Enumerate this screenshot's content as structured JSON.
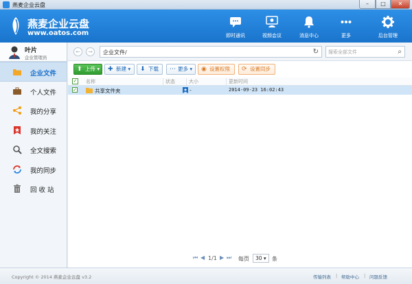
{
  "window": {
    "title": "燕麦企业云盘",
    "min": "–",
    "max": "□",
    "close": "✕"
  },
  "brand": {
    "name": "燕麦企业云盘",
    "url": "www.oatos.com",
    "accent": "#1f7fd8"
  },
  "header_buttons": [
    {
      "label": "即时通讯",
      "icon": "chat-icon"
    },
    {
      "label": "视频会议",
      "icon": "video-conference-icon"
    },
    {
      "label": "消息中心",
      "icon": "bell-icon"
    },
    {
      "label": "更多",
      "icon": "more-dots-icon"
    },
    {
      "label": "后台管理",
      "icon": "gear-icon"
    }
  ],
  "user": {
    "name": "叶片",
    "role": "企业管理员"
  },
  "sidebar": {
    "items": [
      {
        "label": "企业文件",
        "icon": "enterprise-files-icon",
        "active": true
      },
      {
        "label": "个人文件",
        "icon": "briefcase-icon",
        "active": false
      },
      {
        "label": "我的分享",
        "icon": "share-icon",
        "active": false
      },
      {
        "label": "我的关注",
        "icon": "bookmark-icon",
        "active": false
      },
      {
        "label": "全文搜索",
        "icon": "magnifier-icon",
        "active": false
      },
      {
        "label": "我的同步",
        "icon": "sync-icon",
        "active": false
      },
      {
        "label": "回 收 站",
        "icon": "trash-icon",
        "active": false
      }
    ]
  },
  "address": {
    "back": "←",
    "forward": "→",
    "path": "企业文件/",
    "refresh": "↻",
    "search_placeholder": "搜索全部文件",
    "search_icon": "⌕"
  },
  "toolbar": {
    "upload": "上传",
    "new": "新建",
    "download": "下载",
    "more": "更多",
    "set_permission": "设置权限",
    "set_sync": "设置同步"
  },
  "table": {
    "headers": [
      "名称",
      "状态",
      "大小",
      "更新时间"
    ],
    "rows": [
      {
        "name": "共享文件夹",
        "status": "",
        "size": "-",
        "updated": "2014-09-23 16:02:43",
        "checked": true
      }
    ]
  },
  "pager": {
    "first": "⏮",
    "prev": "◀",
    "page": "1/1",
    "next": "▶",
    "last": "⏭",
    "per_page_label": "每页",
    "per_page": "30",
    "unit": "条"
  },
  "status": {
    "copyright": "Copyright © 2014 燕麦企业云盘 v3.2",
    "links": [
      "传输列表",
      "帮助中心",
      "问题反馈"
    ]
  }
}
